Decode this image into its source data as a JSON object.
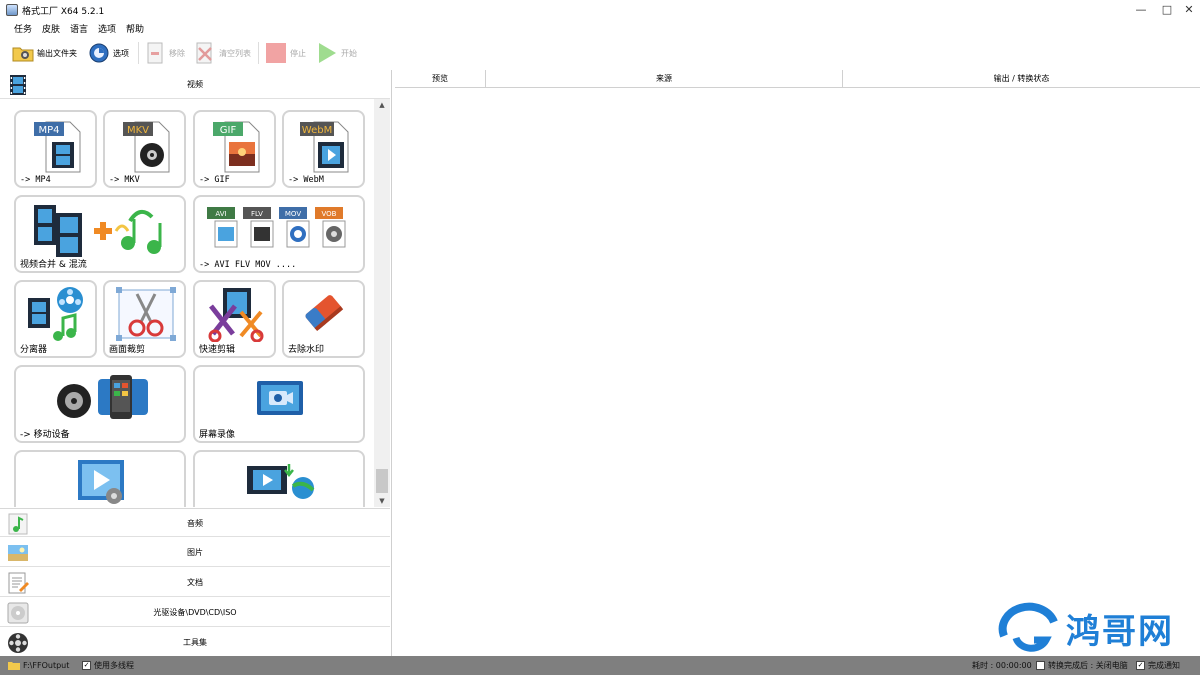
{
  "window": {
    "title": "格式工厂 X64 5.2.1",
    "controls": [
      "—",
      "□",
      "✕"
    ]
  },
  "menu": [
    "任务",
    "皮肤",
    "语言",
    "选项",
    "帮助"
  ],
  "toolbar": {
    "output_folder": "输出文件夹",
    "options": "选项",
    "remove": "移除",
    "clear_list": "清空列表",
    "stop": "停止",
    "start": "开始"
  },
  "categories": {
    "video": "视频",
    "audio": "音频",
    "image": "图片",
    "document": "文档",
    "disc": "光驱设备\\DVD\\CD\\ISO",
    "tools": "工具集"
  },
  "tiles": {
    "mp4": {
      "label": "-> MP4",
      "badge": "MP4"
    },
    "mkv": {
      "label": "-> MKV",
      "badge": "MKV"
    },
    "gif": {
      "label": "-> GIF",
      "badge": "GIF"
    },
    "webm": {
      "label": "-> WebM",
      "badge": "WebM"
    },
    "merge": {
      "label": "视频合并 & 混流"
    },
    "multi": {
      "label": "-> AVI FLV MOV ....",
      "badges": [
        "AVI",
        "FLV",
        "MOV",
        "VOB"
      ]
    },
    "splitter": {
      "label": "分离器"
    },
    "crop": {
      "label": "画面裁剪"
    },
    "quick_cut": {
      "label": "快速剪辑"
    },
    "remove_watermark": {
      "label": "去除水印"
    },
    "mobile": {
      "label": "-> 移动设备"
    },
    "screen_record": {
      "label": "屏幕录像"
    }
  },
  "columns": {
    "preview": "预览",
    "source": "来源",
    "output_status": "输出 / 转换状态"
  },
  "statusbar": {
    "output_path": "F:\\FFOutput",
    "multithread": "使用多线程",
    "elapsed_label": "耗时 : 00:00:00",
    "after_convert": "转换完成后 : 关闭电脑",
    "notify": "完成通知"
  },
  "watermark": {
    "text": "鸿哥网"
  }
}
